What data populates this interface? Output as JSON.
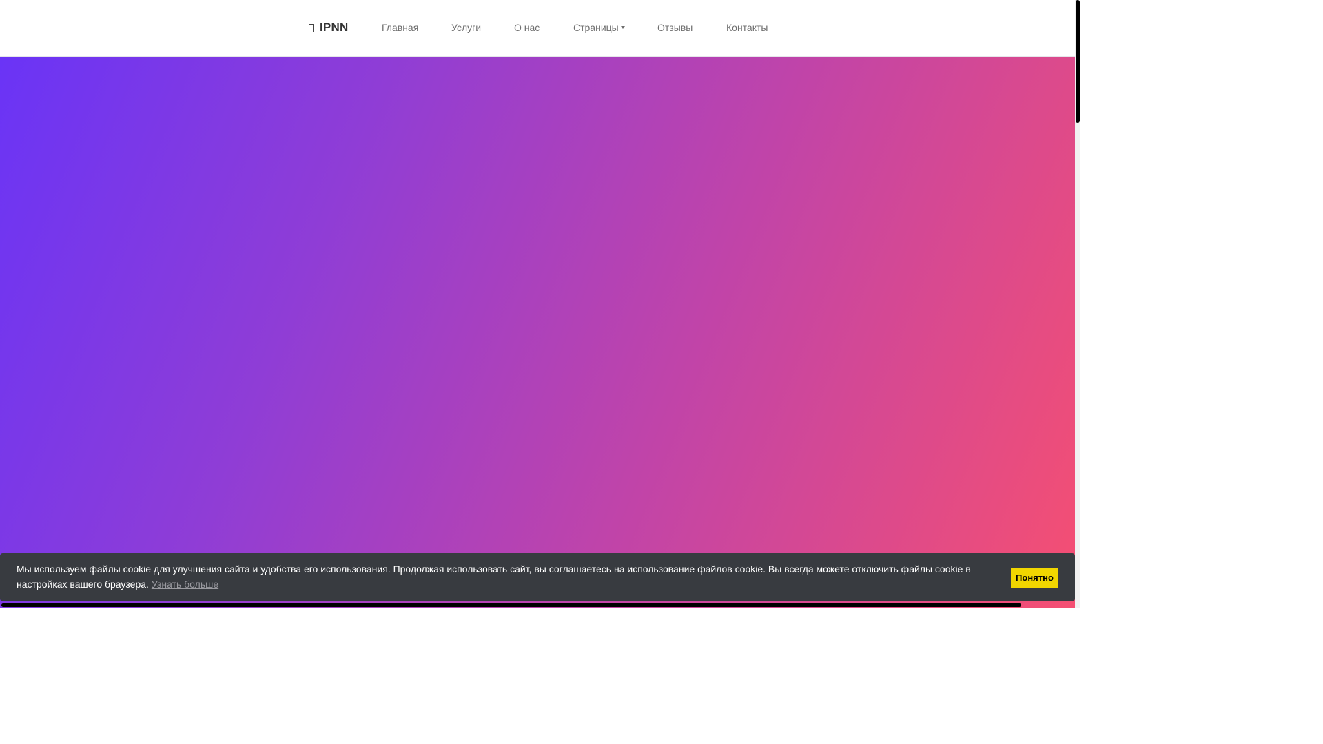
{
  "navbar": {
    "brand": "IPNN",
    "brand_icon": "bookmark-icon",
    "links": {
      "home": "Главная",
      "services": "Услуги",
      "about": "О нас",
      "pages": "Страницы",
      "reviews": "Отзывы",
      "contacts": "Контакты"
    }
  },
  "hero": {
    "gradient_colors": [
      "#6a34f6",
      "#c044a9",
      "#f54f72"
    ]
  },
  "cookie_banner": {
    "message": "Мы используем файлы cookie для улучшения сайта и удобства его использования. Продолжая использовать сайт, вы соглашаетесь на использование файлов cookie. Вы всегда можете отключить файлы cookie в настройках вашего браузера.",
    "learn_more": "Узнать больше",
    "accept_button": "Понятно",
    "background_color": "#383b40",
    "button_color": "#f1d600"
  }
}
